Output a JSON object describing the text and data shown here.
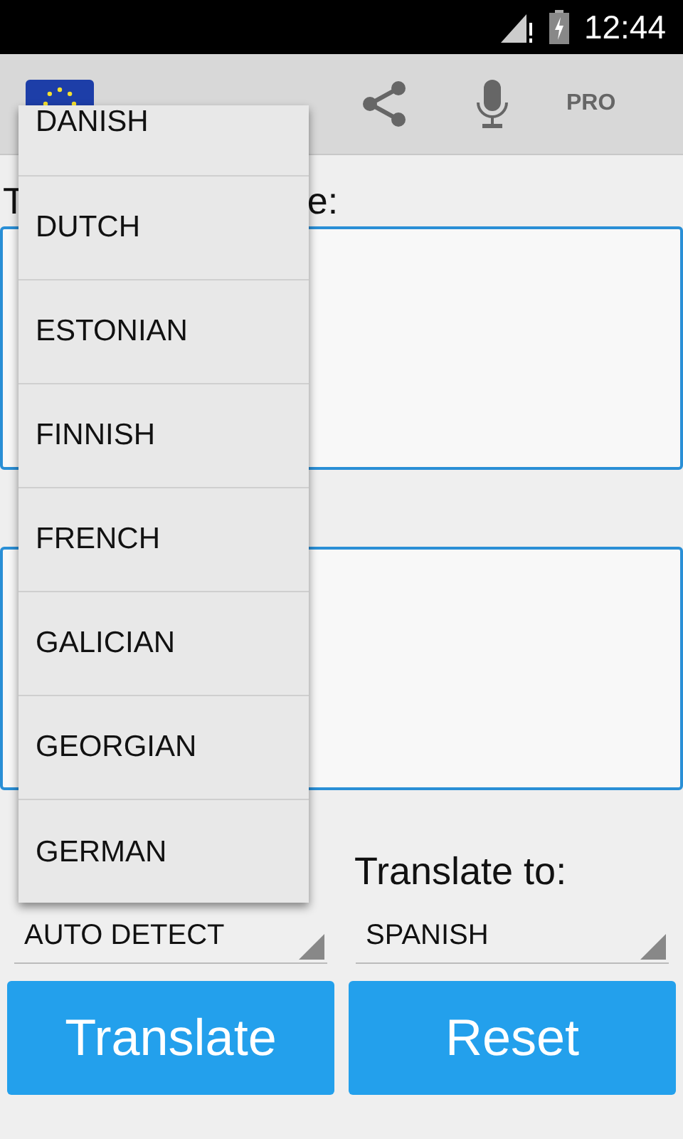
{
  "status_bar": {
    "time": "12:44"
  },
  "action_bar": {
    "pro": "PRO"
  },
  "source_label_fragments": [
    "T",
    "e:"
  ],
  "target_label": "Translate to:",
  "source_spinner": "AUTO DETECT",
  "target_spinner": "SPANISH",
  "buttons": [
    "Translate",
    "Reset"
  ],
  "language_menu": [
    "DANISH",
    "DUTCH",
    "ESTONIAN",
    "FINNISH",
    "FRENCH",
    "GALICIAN",
    "GEORGIAN",
    "GERMAN"
  ]
}
